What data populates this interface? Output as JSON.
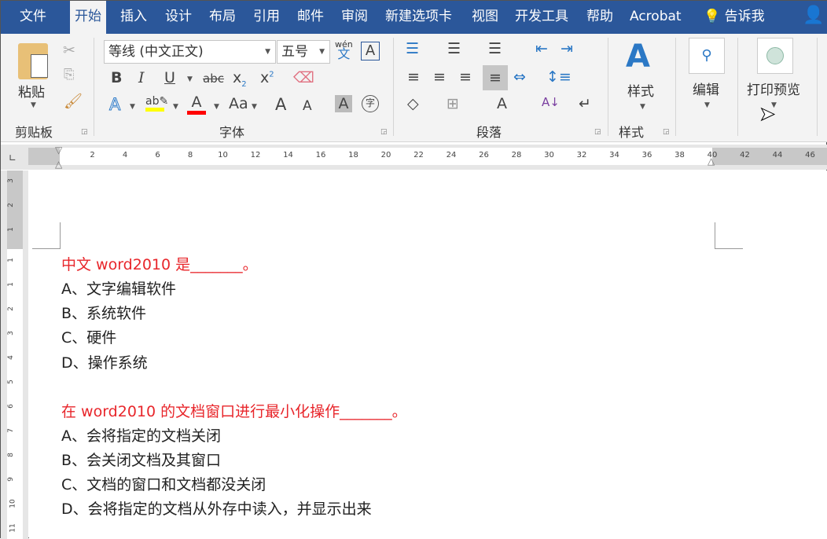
{
  "tabs": [
    "文件",
    "开始",
    "插入",
    "设计",
    "布局",
    "引用",
    "邮件",
    "审阅",
    "新建选项卡",
    "视图",
    "开发工具",
    "帮助",
    "Acrobat"
  ],
  "tell_me": "告诉我",
  "clipboard": {
    "paste": "粘贴",
    "label": "剪贴板"
  },
  "font": {
    "name": "等线 (中文正文)",
    "size": "五号",
    "label": "字体",
    "phonetic_top": "wén",
    "phonetic_bottom": "文",
    "bold": "B",
    "italic": "I",
    "underline": "U",
    "strike": "abc",
    "sub": "x",
    "sub2": "2",
    "sup": "x",
    "sup2": "2",
    "grow": "A",
    "shrink": "A",
    "case": "Aa",
    "shade": "A",
    "enclose": "字",
    "highlight_color": "#ffff00",
    "font_color": "#ff0000"
  },
  "paragraph": {
    "label": "段落"
  },
  "styles": {
    "button": "样式",
    "label": "样式"
  },
  "editing": {
    "button": "编辑"
  },
  "print_preview": {
    "button": "打印预览"
  },
  "ruler": {
    "h_labels": [
      "2",
      "4",
      "6",
      "8",
      "10",
      "12",
      "14",
      "16",
      "18",
      "20",
      "22",
      "24",
      "26",
      "28",
      "30",
      "32",
      "34",
      "36",
      "38",
      "40",
      "42",
      "44",
      "46"
    ],
    "v_labels": [
      "3",
      "2",
      "1",
      "1",
      "1",
      "2",
      "3",
      "4",
      "5",
      "6",
      "7",
      "8",
      "9",
      "10",
      "11"
    ]
  },
  "document": {
    "lines": [
      {
        "text": "中文 word2010 是_______。",
        "question": true
      },
      {
        "text": "A、文字编辑软件"
      },
      {
        "text": "B、系统软件"
      },
      {
        "text": "C、硬件"
      },
      {
        "text": "D、操作系统"
      },
      {
        "text": "在 word2010 的文档窗口进行最小化操作_______。",
        "question": true
      },
      {
        "text": "A、会将指定的文档关闭"
      },
      {
        "text": "B、会关闭文档及其窗口"
      },
      {
        "text": "C、文档的窗口和文档都没关闭"
      },
      {
        "text": "D、会将指定的文档从外存中读入，并显示出来"
      }
    ]
  }
}
